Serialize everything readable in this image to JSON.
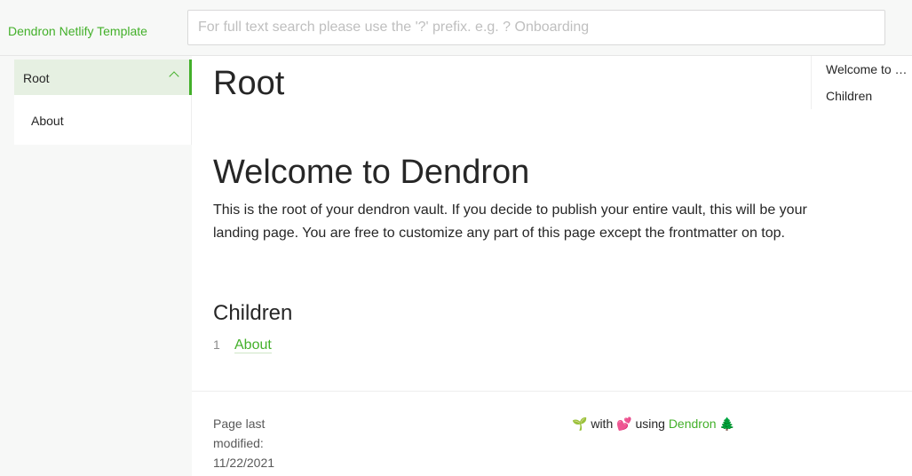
{
  "header": {
    "site_title": "Dendron Netlify Template",
    "search_placeholder": "For full text search please use the '?' prefix. e.g. ? Onboarding",
    "search_value": ""
  },
  "sidebar": {
    "items": [
      {
        "label": "Root",
        "selected": true,
        "icon": "chevron-up-icon"
      },
      {
        "label": "About",
        "selected": false
      }
    ],
    "accent_color": "#43b02a",
    "selected_bg": "#e6f0e2"
  },
  "main": {
    "page_title": "Root",
    "heading": "Welcome to Dendron",
    "intro": "This is the root of your dendron vault. If you decide to publish your entire vault, this will be your landing page. You are free to customize any part of this page except the frontmatter on top.",
    "children_heading": "Children",
    "children": [
      {
        "number": "1",
        "label": "About"
      }
    ]
  },
  "toc": {
    "items": [
      {
        "label": "Welcome to Dendron"
      },
      {
        "label": "Children"
      }
    ]
  },
  "footer": {
    "modified_label": "Page last modified:",
    "modified_date": "11/22/2021",
    "seedling_emoji": "🌱",
    "with_text": " with ",
    "hearts_emoji": "💕",
    "using_text": " using ",
    "dendron_link": "Dendron",
    "tree_emoji": "🌲"
  }
}
